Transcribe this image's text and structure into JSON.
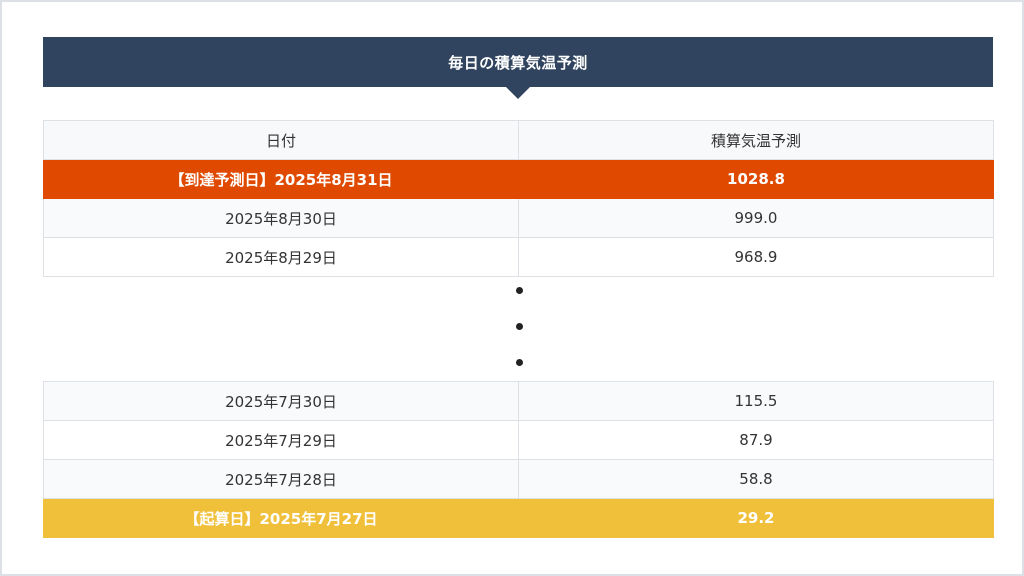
{
  "title": "毎日の積算気温予測",
  "table": {
    "headers": [
      "日付",
      "積算気温予測"
    ],
    "top_rows": [
      {
        "date": "【到達予測日】2025年8月31日",
        "value": "1028.8",
        "kind": "target"
      },
      {
        "date": "2025年8月30日",
        "value": "999.0",
        "kind": "plain"
      },
      {
        "date": "2025年8月29日",
        "value": "968.9",
        "kind": "plain"
      }
    ],
    "bottom_rows": [
      {
        "date": "2025年7月30日",
        "value": "115.5",
        "kind": "plain"
      },
      {
        "date": "2025年7月29日",
        "value": "87.9",
        "kind": "plain"
      },
      {
        "date": "2025年7月28日",
        "value": "58.8",
        "kind": "plain"
      },
      {
        "date": "【起算日】2025年7月27日",
        "value": "29.2",
        "kind": "start"
      }
    ]
  },
  "colors": {
    "banner": "#31445f",
    "target_row": "#e04a00",
    "start_row": "#f0c03a"
  }
}
